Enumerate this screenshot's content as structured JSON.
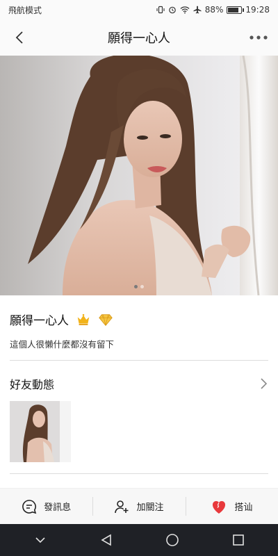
{
  "status_bar": {
    "carrier": "飛航模式",
    "battery": "88%",
    "battery_level": 0.88,
    "time": "19:28",
    "icons": [
      "vibrate-icon",
      "alarm-icon",
      "wifi-icon",
      "airplane-icon",
      "battery-icon"
    ]
  },
  "nav": {
    "title": "願得一心人",
    "back_icon": "chevron-left-icon",
    "more_icon": "more-icon"
  },
  "hero": {
    "photo": "profile-photo",
    "page_count": 2,
    "active_page": 1
  },
  "profile": {
    "name": "願得一心人",
    "badges": [
      "crown-icon",
      "diamond-icon"
    ],
    "bio": "這個人很懶什麼都沒有留下"
  },
  "moments": {
    "title": "好友動態",
    "arrow_icon": "chevron-right-icon"
  },
  "actions": [
    {
      "label": "發訊息",
      "icon": "message-icon"
    },
    {
      "label": "加關注",
      "icon": "add-follow-icon"
    },
    {
      "label": "搭讪",
      "icon": "heart-icon"
    }
  ],
  "colors": {
    "heart": "#e8393c",
    "crown": "#f2b31a",
    "diamond": "#f5c542",
    "sys_nav_bg": "#1f2126"
  }
}
